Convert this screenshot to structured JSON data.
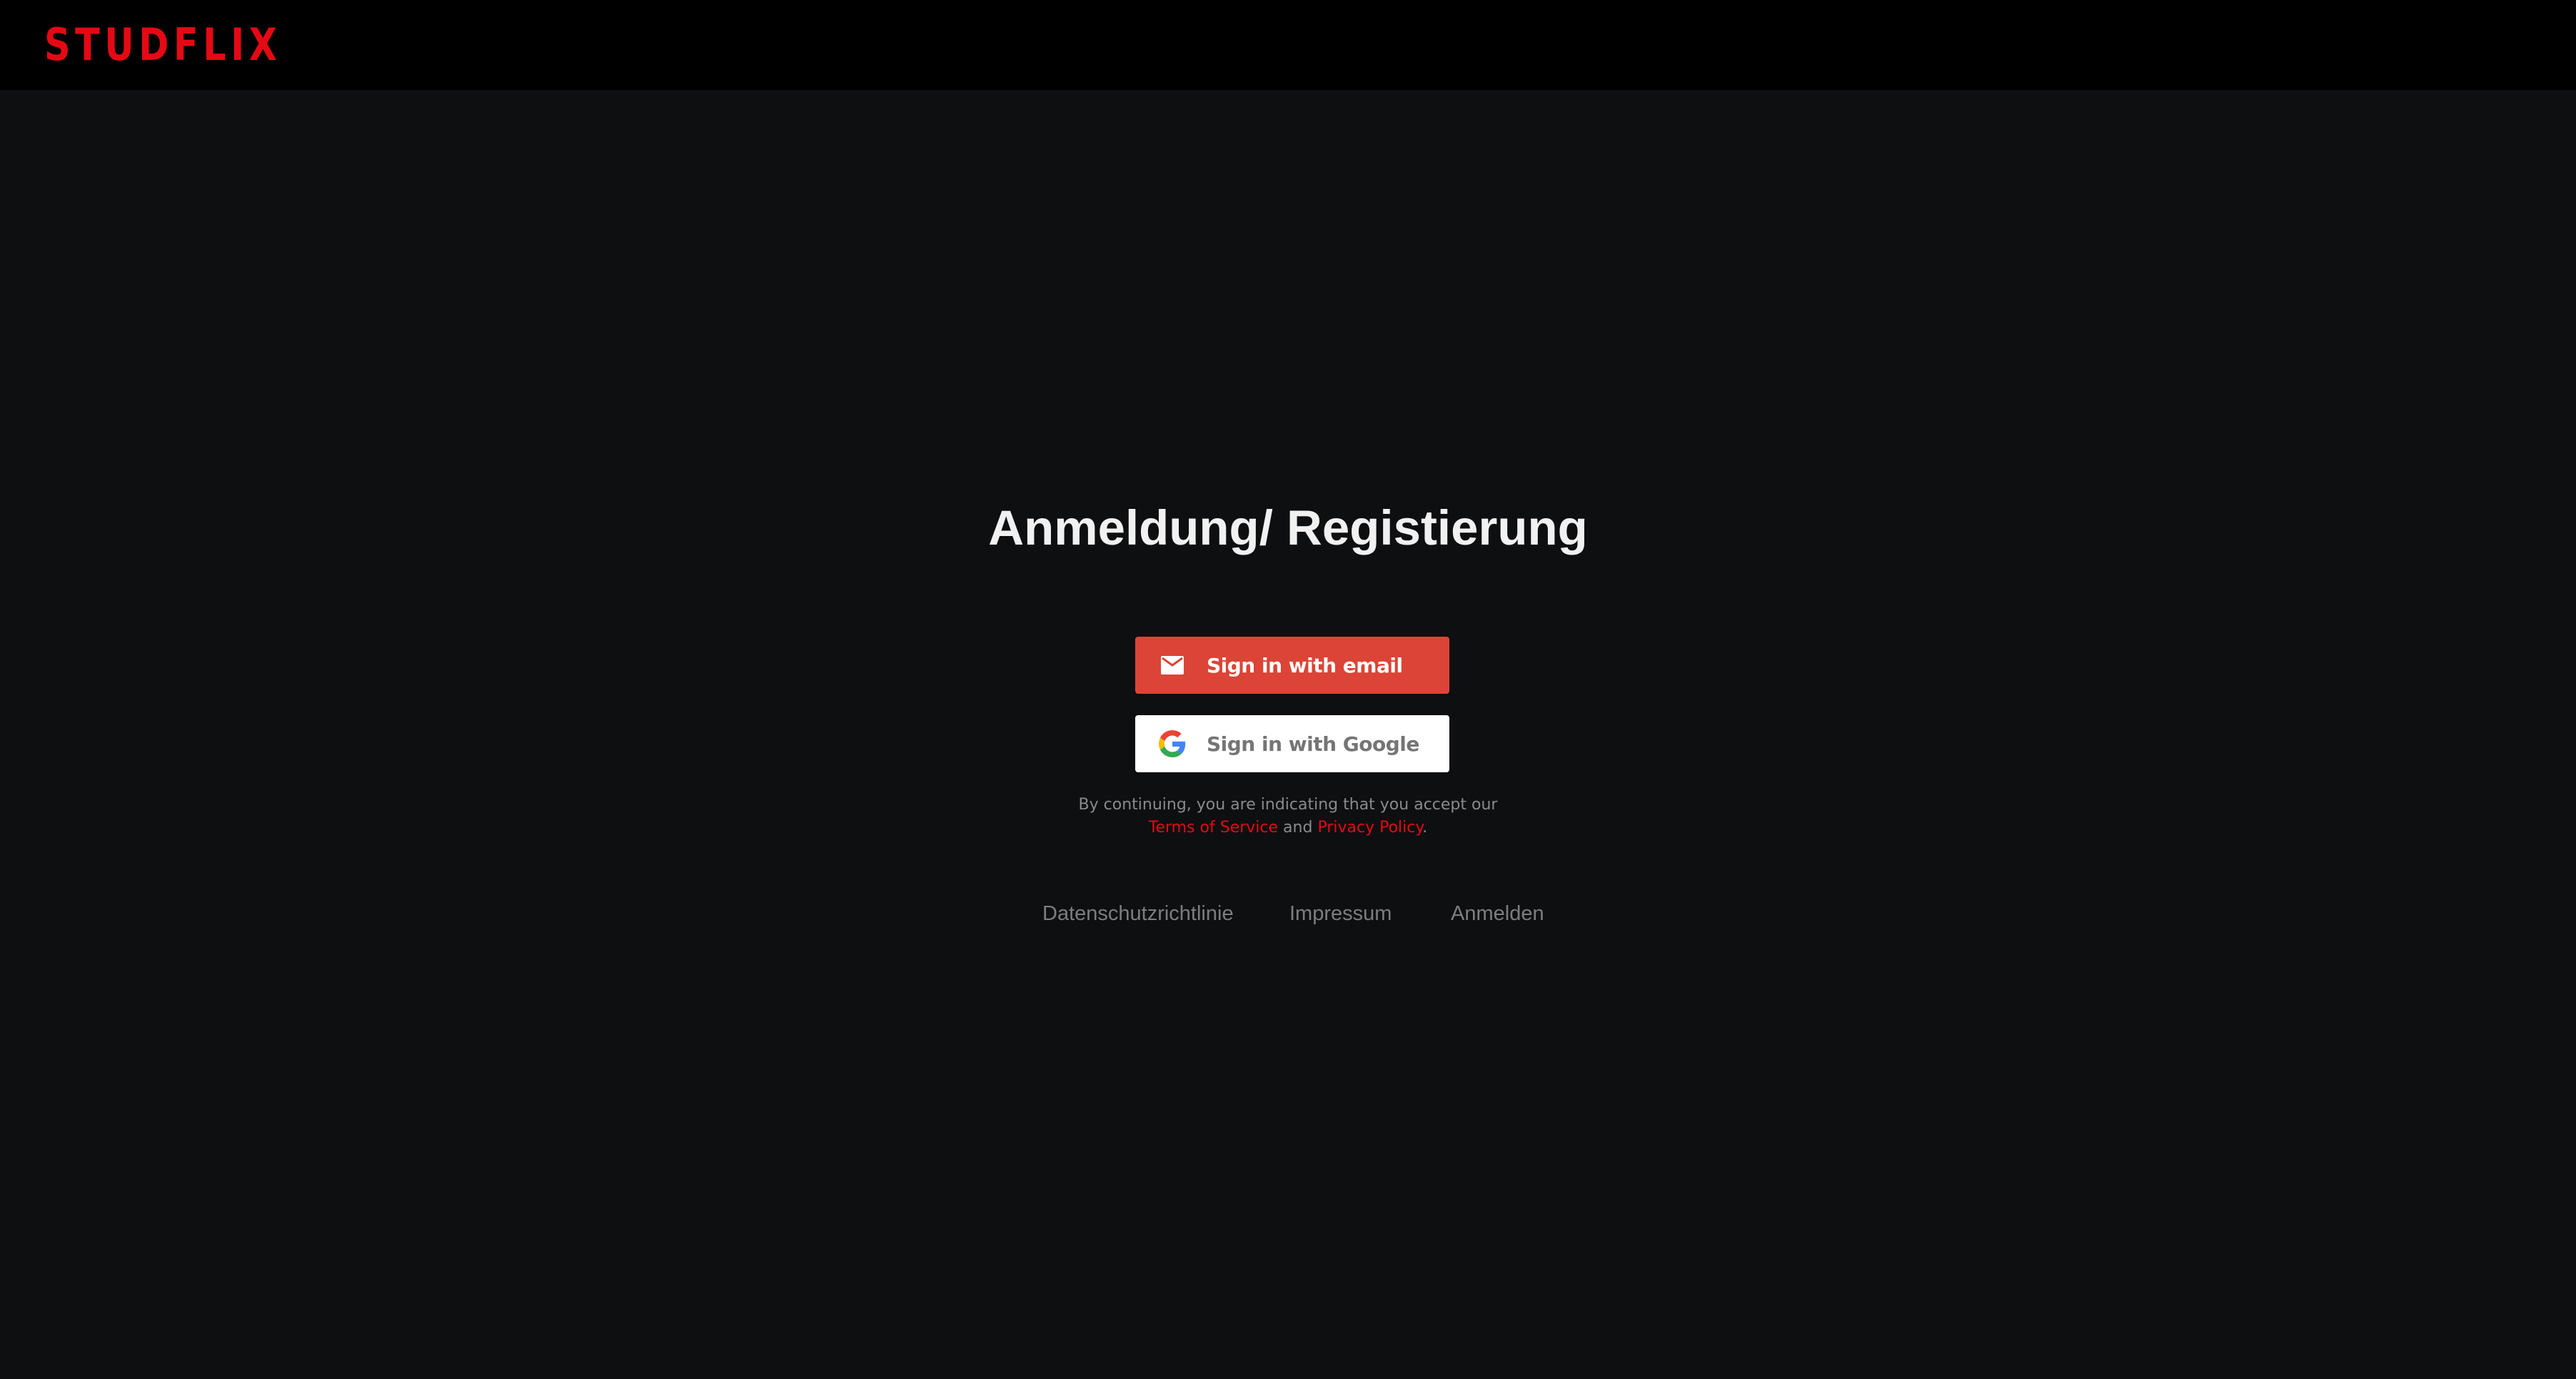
{
  "header": {
    "logo_text": "STUDFLIX",
    "logo_color": "#e50914"
  },
  "main": {
    "title": "Anmeldung/ Registierung",
    "email_button": {
      "label": "Sign in with email",
      "icon": "mail-icon",
      "background": "#db4437"
    },
    "google_button": {
      "label": "Sign in with Google",
      "icon": "google-icon",
      "background": "#ffffff"
    },
    "tos": {
      "line1": "By continuing, you are indicating that you accept our",
      "terms_link": "Terms of Service",
      "and_text": "and",
      "privacy_link": "Privacy Policy",
      "end_punct": "."
    }
  },
  "footer": {
    "links": [
      {
        "label": "Datenschutzrichtlinie"
      },
      {
        "label": "Impressum"
      },
      {
        "label": "Anmelden"
      }
    ]
  },
  "colors": {
    "page_background": "#0e0f11",
    "topbar_background": "#000000",
    "accent": "#e50914"
  }
}
